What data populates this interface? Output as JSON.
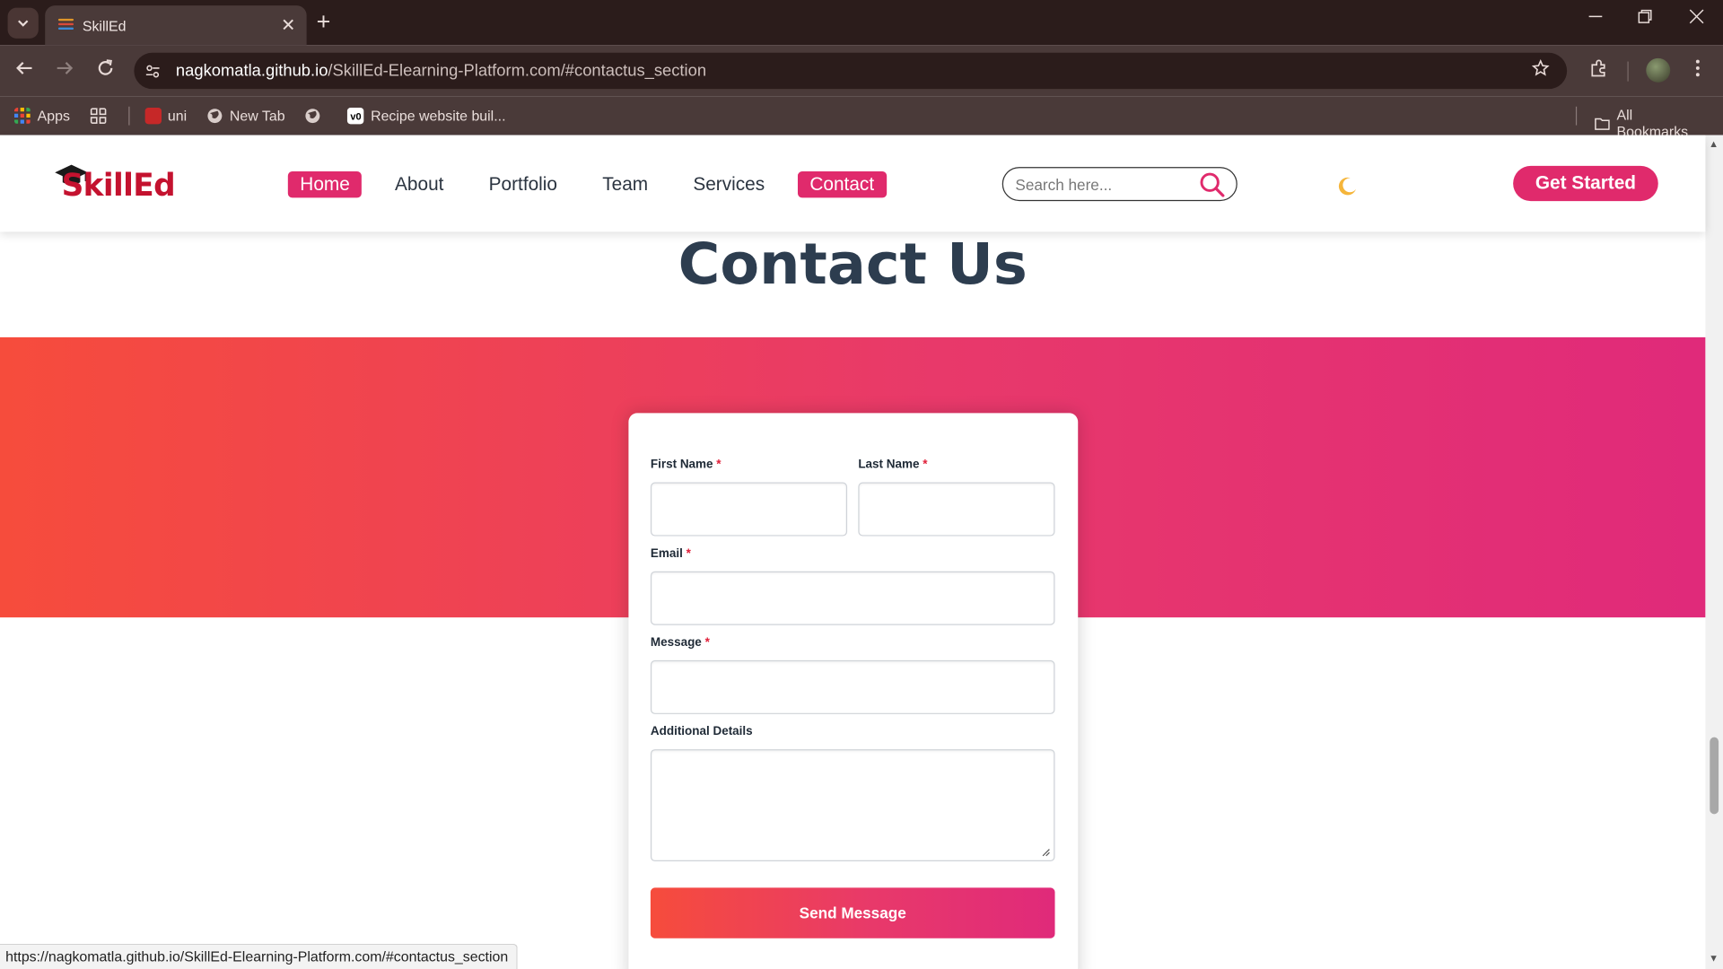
{
  "browser": {
    "tab_title": "SkillEd",
    "url_host": "nagkomatla.github.io",
    "url_path": "/SkillEd-Elearning-Platform.com/#contactus_section",
    "bookmarks": [
      {
        "label": "Apps"
      },
      {
        "label": ""
      },
      {
        "label": "uni"
      },
      {
        "label": "New Tab"
      },
      {
        "label": ""
      },
      {
        "label": "Recipe website buil..."
      }
    ],
    "all_bookmarks": "All Bookmarks",
    "status_url": "https://nagkomatla.github.io/SkillEd-Elearning-Platform.com/#contactus_section"
  },
  "header": {
    "logo_text": "SkillEd",
    "nav": [
      "Home",
      "About",
      "Portfolio",
      "Team",
      "Services",
      "Contact"
    ],
    "search_placeholder": "Search here...",
    "cta_label": "Get Started"
  },
  "contact": {
    "title": "Contact Us",
    "first_name_label": "First Name",
    "last_name_label": "Last Name",
    "email_label": "Email",
    "message_label": "Message",
    "details_label": "Additional Details",
    "required_mark": "*",
    "send_label": "Send Message"
  },
  "colors": {
    "accent": "#e02a6c",
    "gradient_start": "#f64c3c",
    "gradient_end": "#e02a7a",
    "chrome_dark": "#2b1c1b",
    "chrome_mid": "#4a3a39"
  }
}
